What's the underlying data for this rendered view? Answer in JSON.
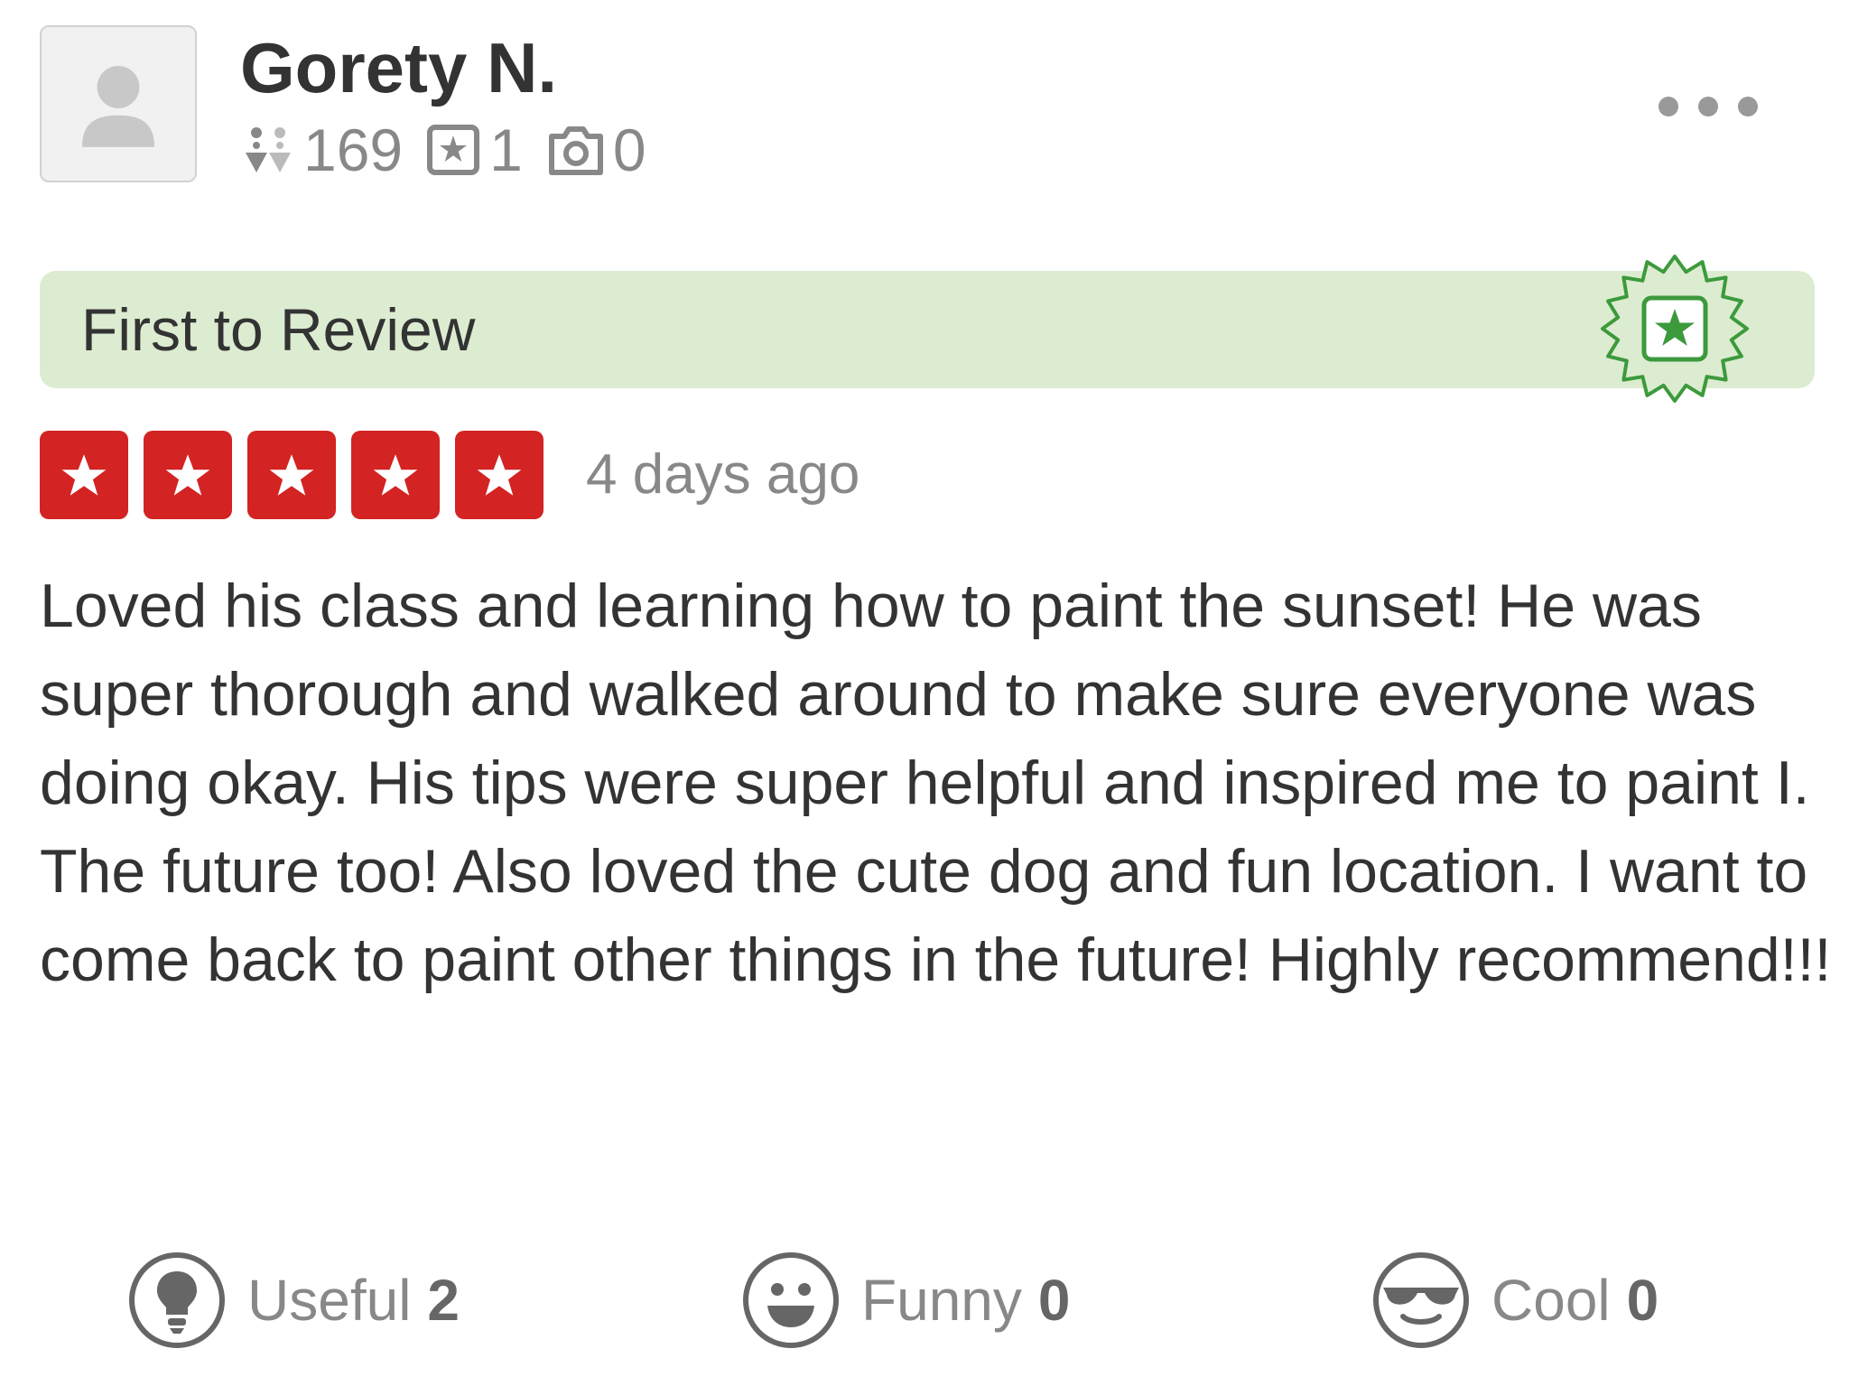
{
  "user": {
    "name": "Gorety N.",
    "avatar_icon": "default-user-avatar-icon",
    "stats": {
      "friends": "169",
      "reviews": "1",
      "photos": "0"
    }
  },
  "menu": {
    "more_icon": "ellipsis-icon"
  },
  "banner": {
    "label": "First to Review",
    "badge_icon": "first-to-review-star-badge-icon",
    "background": "#dcecd0",
    "accent": "#3c9a3c"
  },
  "review": {
    "rating": 5,
    "rating_max": 5,
    "star_color": "#d32323",
    "date": "4 days ago",
    "text": "Loved his class and learning how to paint the sunset! He was super thorough and walked around to make sure everyone was doing okay. His tips were super helpful and inspired me to paint I. The future too! Also loved the cute dog and fun location. I want to come back to paint other things in the future! Highly recommend!!!"
  },
  "reactions": {
    "useful": {
      "label": "Useful",
      "count": "2",
      "icon": "lightbulb-icon"
    },
    "funny": {
      "label": "Funny",
      "count": "0",
      "icon": "smiley-icon"
    },
    "cool": {
      "label": "Cool",
      "count": "0",
      "icon": "sunglasses-face-icon"
    }
  }
}
